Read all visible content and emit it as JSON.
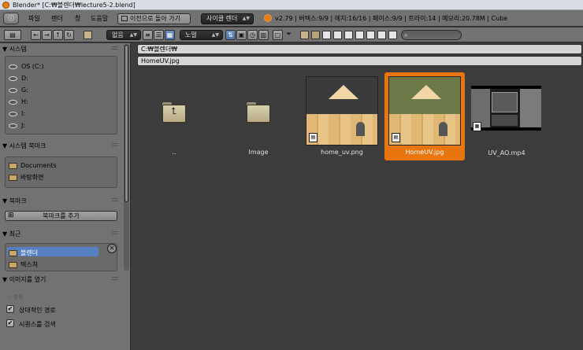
{
  "window": {
    "title": "Blender* [C:₩블렌더₩lecture5-2.blend]"
  },
  "info_header": {
    "editor_icon": "info-icon",
    "menus": [
      "파일",
      "렌더",
      "창",
      "도움말"
    ],
    "back_button": "이전으로 돌아 가기",
    "render_engine": "사이클 렌더",
    "stats": "v2.79 | 버텍스:9/9 | 에지:16/16 | 페이스:9/9 | 트라이:14 | 메모리:20.78M | Cube"
  },
  "file_header": {
    "sort_select": "없음",
    "display_select": "노멀"
  },
  "left_panel": {
    "system": {
      "title": "▼ 시스템",
      "drives": [
        "OS (C:)",
        "D:",
        "G:",
        "H:",
        "I:",
        "J:"
      ]
    },
    "system_bookmarks": {
      "title": "▼ 시스템 북마크",
      "items": [
        "Documents",
        "바탕화면"
      ]
    },
    "bookmarks": {
      "title": "▼ 북마크",
      "add_button": "북마크를 추가"
    },
    "recent": {
      "title": "▼ 최근",
      "items": [
        "블렌더",
        "텍스쳐"
      ]
    },
    "open_image": {
      "title": "▼ 이미지를 열기",
      "subtitle": "◇ 항목",
      "options": [
        {
          "label": "상대적인 경로",
          "checked": true
        },
        {
          "label": "시퀀스를 검색",
          "checked": true
        }
      ]
    }
  },
  "paths": {
    "directory": "C:₩블렌더₩",
    "filename": "HomeUV.jpg"
  },
  "files": [
    {
      "name": "..",
      "kind": "parent-folder"
    },
    {
      "name": "Image",
      "kind": "folder"
    },
    {
      "name": "home_uv.png",
      "kind": "image",
      "bg": "#3b3b3d"
    },
    {
      "name": "HomeUV.jpg",
      "kind": "image",
      "bg": "#6b7a48",
      "selected": true
    },
    {
      "name": "UV_AO.mp4",
      "kind": "video"
    }
  ],
  "colors": {
    "selection": "#e8750d",
    "recent_highlight": "#5680c2"
  }
}
